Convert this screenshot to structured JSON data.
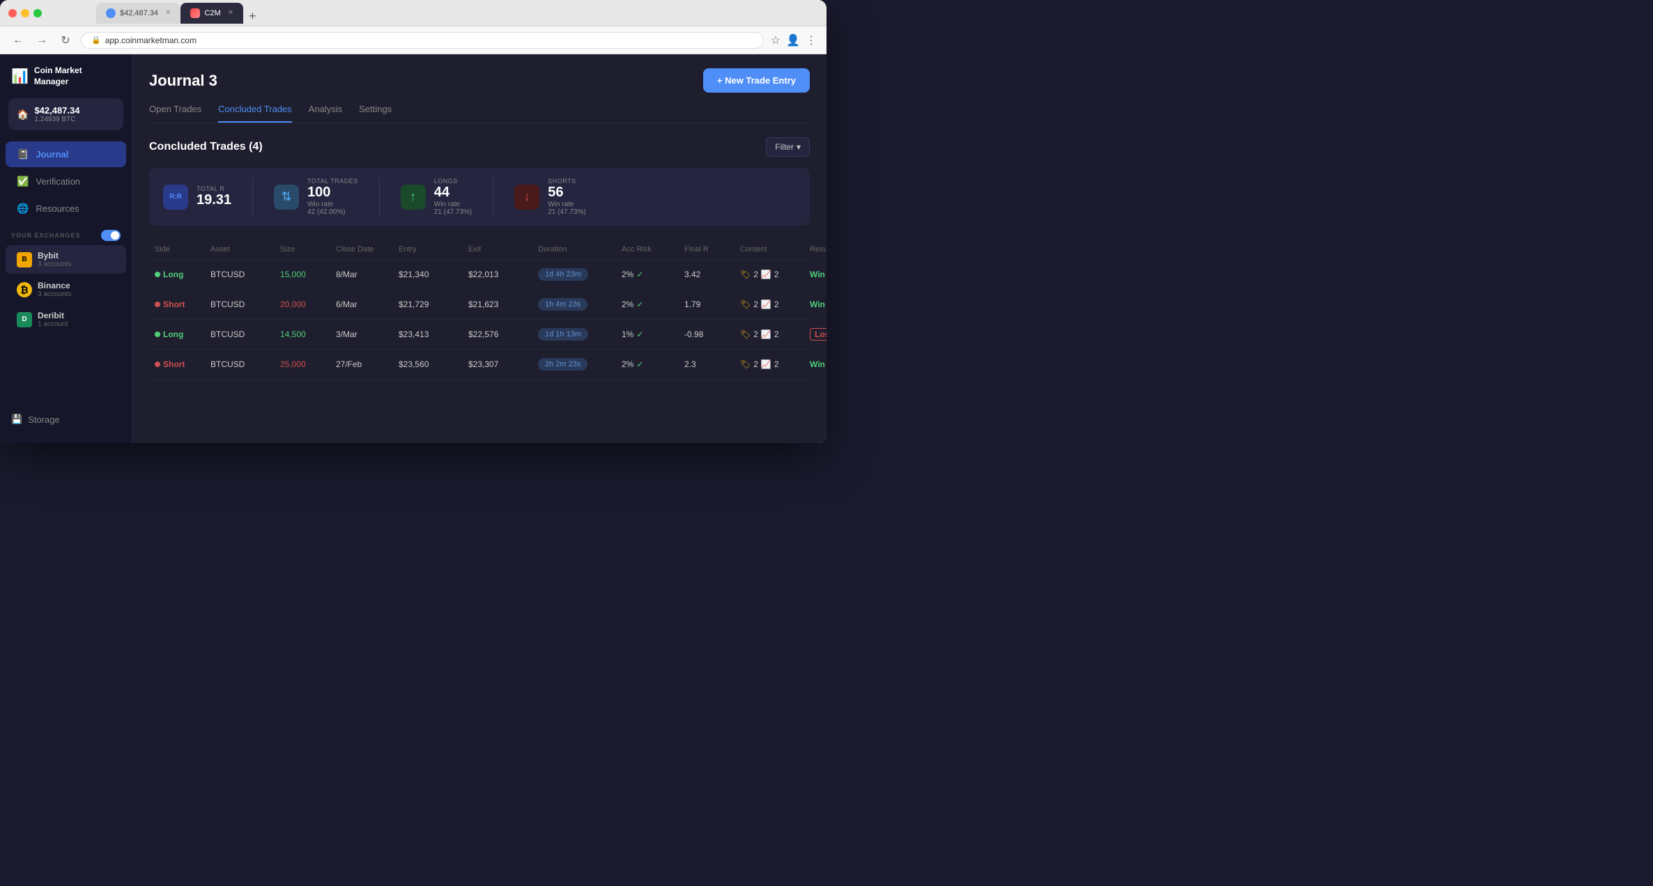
{
  "browser": {
    "tab1": {
      "label": "$42,487.34",
      "active": false
    },
    "tab2": {
      "label": "C2M",
      "active": true
    },
    "address": "app.coinmarketman.com"
  },
  "sidebar": {
    "logo": "Coin Market\nManager",
    "balance": {
      "usd": "$42,487.34",
      "btc": "1.24939 BTC"
    },
    "nav": [
      {
        "label": "Journal",
        "active": true
      },
      {
        "label": "Verification",
        "active": false
      },
      {
        "label": "Resources",
        "active": false
      }
    ],
    "exchanges_section": "YOUR EXCHANGES",
    "exchanges": [
      {
        "name": "Bybit",
        "accounts": "3 accounts"
      },
      {
        "name": "Binance",
        "accounts": "3 accounts"
      },
      {
        "name": "Deribit",
        "accounts": "1 account"
      }
    ],
    "storage": "Storage"
  },
  "page": {
    "title": "Journal 3",
    "new_trade_btn": "+ New Trade Entry",
    "tabs": [
      "Open Trades",
      "Concluded Trades",
      "Analysis",
      "Settings"
    ],
    "active_tab": "Concluded Trades"
  },
  "concluded": {
    "section_title": "Concluded Trades (4)",
    "filter_btn": "Filter",
    "stats": {
      "rr": {
        "label": "Total R",
        "value": "19.31"
      },
      "trades": {
        "label": "Total trades",
        "value": "100",
        "sub": "42 (42.00%)",
        "sub_label": "Win rate"
      },
      "longs": {
        "label": "Longs",
        "value": "44",
        "sub": "21 (47.73%)",
        "sub_label": "Win rate"
      },
      "shorts": {
        "label": "Shorts",
        "value": "56",
        "sub": "21 (47.73%)",
        "sub_label": "Win rate"
      }
    },
    "columns": [
      "Side",
      "Asset",
      "Size",
      "Close Date",
      "Entry",
      "Exit",
      "Duration",
      "Acc Risk",
      "Final R",
      "Content",
      "Result"
    ],
    "rows": [
      {
        "side": "Long",
        "side_type": "long",
        "asset": "BTCUSD",
        "size": "15,000",
        "close_date": "8/Mar",
        "entry": "$21,340",
        "exit": "$22,013",
        "duration": "1d 4h 23m",
        "acc_risk": "2%",
        "final_r": "3.42",
        "content_tags": "2",
        "content_charts": "2",
        "result": "Win",
        "result_type": "win"
      },
      {
        "side": "Short",
        "side_type": "short",
        "asset": "BTCUSD",
        "size": "20,000",
        "close_date": "6/Mar",
        "entry": "$21,729",
        "exit": "$21,623",
        "duration": "1h 4m 23s",
        "acc_risk": "2%",
        "final_r": "1.79",
        "content_tags": "2",
        "content_charts": "2",
        "result": "Win",
        "result_type": "win"
      },
      {
        "side": "Long",
        "side_type": "long",
        "asset": "BTCUSD",
        "size": "14,500",
        "close_date": "3/Mar",
        "entry": "$23,413",
        "exit": "$22,576",
        "duration": "1d 1h 13m",
        "acc_risk": "1%",
        "final_r": "-0.98",
        "content_tags": "2",
        "content_charts": "2",
        "result": "Lose",
        "result_type": "lose"
      },
      {
        "side": "Short",
        "side_type": "short",
        "asset": "BTCUSD",
        "size": "25,000",
        "close_date": "27/Feb",
        "entry": "$23,560",
        "exit": "$23,307",
        "duration": "2h 2m 23s",
        "acc_risk": "2%",
        "final_r": "2.3",
        "content_tags": "2",
        "content_charts": "2",
        "result": "Win",
        "result_type": "win"
      }
    ]
  }
}
